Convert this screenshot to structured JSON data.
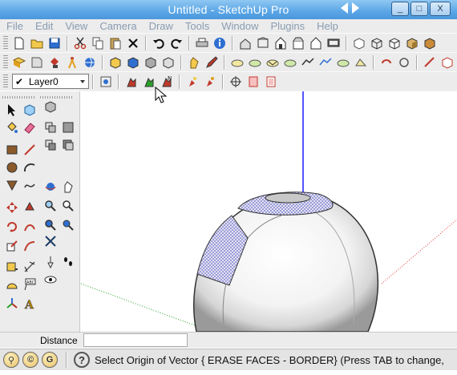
{
  "window": {
    "title": "Untitled - SketchUp Pro"
  },
  "window_controls": {
    "minimize": "_",
    "maximize": "□",
    "close": "X"
  },
  "menu": {
    "items": [
      "File",
      "Edit",
      "View",
      "Camera",
      "Draw",
      "Tools",
      "Window",
      "Plugins",
      "Help"
    ]
  },
  "layers": {
    "current": "Layer0"
  },
  "measurements": {
    "label": "Distance",
    "value": ""
  },
  "status": {
    "icons": [
      "geo-location-icon",
      "credits-icon",
      "google-icon"
    ],
    "credits_glyph": "©",
    "google_glyph": "G",
    "help_glyph": "?",
    "text": "Select Origin of Vector { ERASE FACES - BORDER}  (Press TAB to change,"
  },
  "colors": {
    "title_bar": "#5aa6e6",
    "axis_blue": "#1a1aff",
    "axis_red": "#e03a3a",
    "axis_green": "#2aa02a",
    "selection_dots": "#6b6bc9"
  }
}
